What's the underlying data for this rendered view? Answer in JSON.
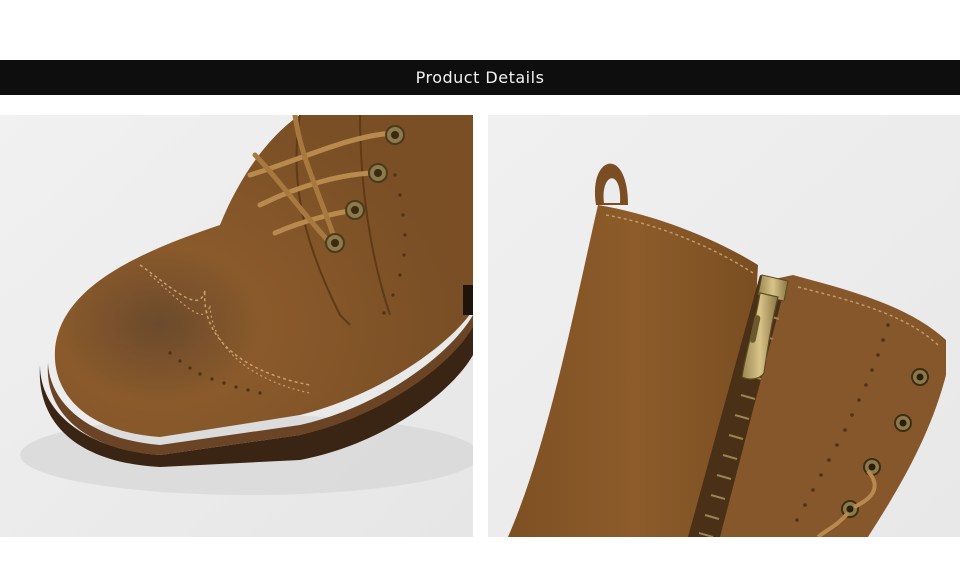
{
  "banner": {
    "title": "Product Details"
  },
  "photos": [
    {
      "subject": "brogue-toe-closeup"
    },
    {
      "subject": "side-zipper-closeup"
    }
  ],
  "colors": {
    "banner_bg": "#0e0e0e",
    "banner_text": "#f2f2f2",
    "suede": "#8a5a2b",
    "suede_dark": "#5e3a18",
    "sole": "#3a2414",
    "eyelet": "#8c7a4a",
    "lace": "#b98a4d"
  }
}
